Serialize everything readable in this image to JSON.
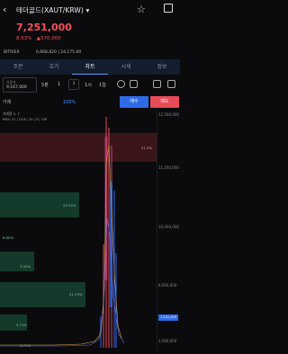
{
  "header": {
    "title": "테더골드(XAUT/KRW) ▾",
    "back_icon": "chevron-left-icon",
    "star_icon": "star-icon",
    "share_icon": "share-icon"
  },
  "ticker": {
    "price": "7,251,000",
    "change_pct": "8.53%",
    "change_abs": "▲570,000",
    "exchange_label": "BITRIEX",
    "exchange_value": "6,668,620 | 24,175.60"
  },
  "tabs": [
    "주문",
    "호가",
    "차트",
    "시세",
    "정보"
  ],
  "active_tab": "차트",
  "toolbar": {
    "timeframe_label": "기준가",
    "timeframe_value": "9,167,000",
    "interval_1": "5",
    "interval_1_unit": "분",
    "interval_2": "1",
    "interval_2_box": "1",
    "interval_3": "1",
    "interval_3_unit": "시",
    "interval_4": "1",
    "interval_4_unit": "일"
  },
  "orderbar": {
    "label": "거래",
    "percent": "100%",
    "buy_label": "매수",
    "sell_label": "매도"
  },
  "chart": {
    "indicator_label": "거래량 5, 7",
    "indicator_values": "MA5: 21 | 12.8 | 10 | 5 | 129",
    "axis_labels": [
      "12,500,000",
      "11,500,000",
      "10,000,000",
      "8,000,000",
      "5,000,000",
      "1,000,000"
    ],
    "profile_labels": [
      "21.3%",
      "23.32%",
      "21.33%",
      "8.00%",
      "3.52%",
      "3.71%",
      "2.71%"
    ],
    "current_price_tag": "7,251,000",
    "colors": {
      "up": "#e84a58",
      "down": "#2f6ae6",
      "volume_profile": "#1e5a40",
      "resistance": "#4a1b20"
    }
  }
}
